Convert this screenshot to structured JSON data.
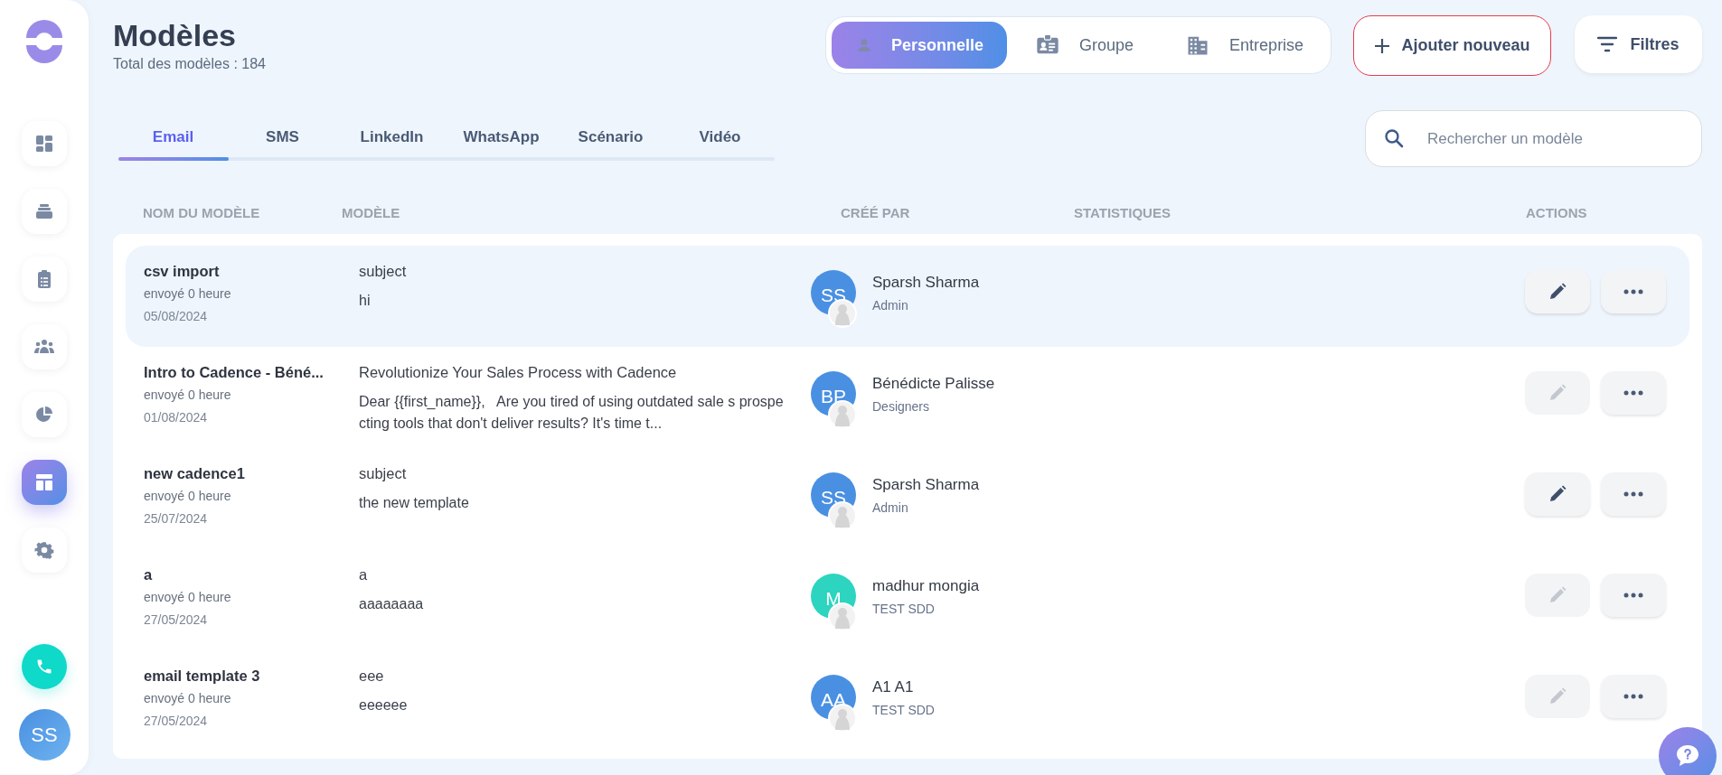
{
  "sidebar": {
    "items": [
      {
        "kind": "dashboard",
        "selected": false
      },
      {
        "kind": "stack",
        "selected": false
      },
      {
        "kind": "clipboard",
        "selected": false
      },
      {
        "kind": "people",
        "selected": false
      },
      {
        "kind": "pie",
        "selected": false
      },
      {
        "kind": "layout",
        "selected": true
      },
      {
        "kind": "settings",
        "selected": false
      }
    ],
    "user_initials": "SS"
  },
  "header": {
    "title": "Modèles",
    "subtitle": "Total des modèles : 184"
  },
  "scope_tabs": [
    {
      "label": "Personnelle",
      "kind": "person",
      "selected": true
    },
    {
      "label": "Groupe",
      "kind": "badge",
      "selected": false
    },
    {
      "label": "Entreprise",
      "kind": "building",
      "selected": false
    }
  ],
  "add_button": "Ajouter nouveau",
  "filter_button": "Filtres",
  "tabs": [
    {
      "label": "Email",
      "selected": true
    },
    {
      "label": "SMS",
      "selected": false
    },
    {
      "label": "LinkedIn",
      "selected": false
    },
    {
      "label": "WhatsApp",
      "selected": false
    },
    {
      "label": "Scénario",
      "selected": false
    },
    {
      "label": "Vidéo",
      "selected": false
    }
  ],
  "search": {
    "placeholder": "Rechercher un modèle"
  },
  "table": {
    "columns": [
      "NOM DU MODÈLE",
      "MODÈLE",
      "CRÉÉ PAR",
      "STATISTIQUES",
      "ACTIONS"
    ],
    "rows": [
      {
        "name": "csv import",
        "sent": "envoyé 0 heure",
        "date": "05/08/2024",
        "subject": "subject",
        "body": "hi",
        "initials": "SS",
        "color": "#4a90e2",
        "creator": "Sparsh Sharma",
        "role": "Admin",
        "edit_disabled": false,
        "selected": true
      },
      {
        "name": "Intro to Cadence - Béné...",
        "sent": "envoyé 0 heure",
        "date": "01/08/2024",
        "subject": "Revolutionize Your Sales Process with Cadence",
        "body": "Dear {{first_name}},   Are you tired of using outdated sale s prospecting tools that don't deliver results? It's time t...",
        "initials": "BP",
        "color": "#4a90e2",
        "creator": "Bénédicte Palisse",
        "role": "Designers",
        "edit_disabled": true,
        "selected": false
      },
      {
        "name": "new cadence1",
        "sent": "envoyé 0 heure",
        "date": "25/07/2024",
        "subject": "subject",
        "body": "the new template",
        "initials": "SS",
        "color": "#4a90e2",
        "creator": "Sparsh Sharma",
        "role": "Admin",
        "edit_disabled": false,
        "selected": false
      },
      {
        "name": "a",
        "sent": "envoyé 0 heure",
        "date": "27/05/2024",
        "subject": "a",
        "body": "aaaaaaaa",
        "initials": "M",
        "color": "#2dd4bf",
        "creator": "madhur mongia",
        "role": "TEST SDD",
        "edit_disabled": true,
        "selected": false
      },
      {
        "name": "email template 3",
        "sent": "envoyé 0 heure",
        "date": "27/05/2024",
        "subject": "eee",
        "body": "eeeeee",
        "initials": "AA",
        "color": "#4a90e2",
        "creator": "A1 A1",
        "role": "TEST SDD",
        "edit_disabled": true,
        "selected": false
      }
    ]
  }
}
